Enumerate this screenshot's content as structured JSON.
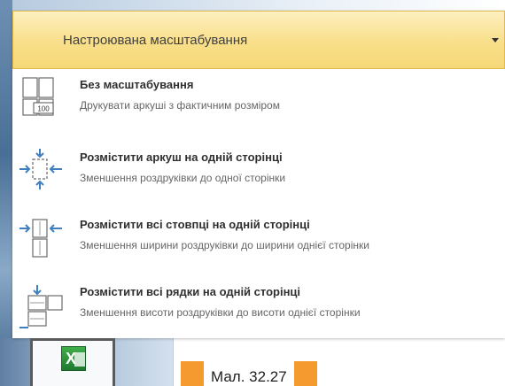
{
  "dropdown": {
    "selected": "Настроювана масштабування",
    "options": [
      {
        "title": "Без масштабування",
        "description": "Друкувати аркуші з фактичним розміром",
        "icon": "no-scaling-icon",
        "icon_label": "100"
      },
      {
        "title": "Розмістити аркуш на одній сторінці",
        "description": "Зменшення роздруківки до одної сторінки",
        "icon": "fit-sheet-icon"
      },
      {
        "title": "Розмістити всі стовпці на одній сторінці",
        "description": "Зменшення ширини роздруківки до ширини однієї сторінки",
        "icon": "fit-columns-icon"
      },
      {
        "title": "Розмістити всі рядки на одній сторінці",
        "description": "Зменшення висоти роздруківки до висоти однієї сторінки",
        "icon": "fit-rows-icon"
      }
    ]
  },
  "app_icon": "excel-icon",
  "caption": "Мал. 32.27",
  "colors": {
    "header": "#f9df8a",
    "caption_accent": "#f59a2f",
    "excel": "#1f7a2e"
  }
}
